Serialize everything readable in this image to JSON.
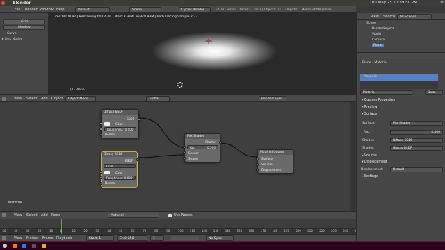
{
  "window": {
    "title": "Blender",
    "clock": "Thu May 25 10:39:50 PM",
    "user": "⚙"
  },
  "infobar": {
    "menus": [
      "File",
      "Render",
      "Window",
      "Help"
    ],
    "layout": "Default",
    "scene": "Scene",
    "engine": "Cycles Render",
    "stats": "v2.79 | Verts:4 | Faces:1 | Tris:2 | Objects:1/3 | Lamps:0/1 | Mem:83.60M | Plane"
  },
  "left_panel": {
    "buttons": [
      "Grid",
      "Monkey"
    ],
    "curve_label": "Curve:",
    "link_nodes": "▸ Link Nodes"
  },
  "viewport": {
    "hud": "Time:00:00.97 | Remaining:00:04.00 | Mem:8.93M, Peak:8.93M | Path Tracing Sample 7/32",
    "object": "(1) Plane"
  },
  "viewport_header": {
    "menus": [
      "View",
      "Select",
      "Add",
      "Object"
    ],
    "mode": "Object Mode",
    "orientation": "Global",
    "layer": "RenderLayer"
  },
  "nodes": {
    "diffuse": {
      "title": "Diffuse BSDF",
      "out": "BSDF",
      "color": "Color",
      "roughness": "Roughness: 0.000",
      "normal": "Normal"
    },
    "glossy": {
      "title": "Glossy BSDF",
      "out": "BSDF",
      "dist": "GGX",
      "color": "Color",
      "roughness": "Roughness: 0.000",
      "normal": "Normal"
    },
    "mix": {
      "title": "Mix Shader",
      "out": "Shader",
      "fac_label": "Fac",
      "fac": "0.500",
      "shader1": "Shader",
      "shader2": "Shader"
    },
    "output": {
      "title": "Material Output",
      "surface": "Surface",
      "volume": "Volume",
      "displacement": "Displacement"
    }
  },
  "node_editor": {
    "material_label": "Material"
  },
  "node_header": {
    "menus": [
      "View",
      "Select",
      "Add",
      "Node"
    ],
    "material": "Material",
    "use_nodes": "Use Nodes"
  },
  "timeline": {
    "ticks": [
      "-50",
      "-40",
      "-30",
      "-20",
      "-10",
      "0",
      "10",
      "20",
      "30",
      "40",
      "50",
      "60",
      "70",
      "80",
      "90",
      "100",
      "110",
      "120",
      "130",
      "140",
      "150",
      "160",
      "170",
      "180",
      "190",
      "200",
      "210",
      "220",
      "230",
      "240",
      "250"
    ],
    "menus": [
      "View",
      "Marker",
      "Frame",
      "Playback"
    ],
    "start": "Start:",
    "start_val": "1",
    "end": "End:",
    "end_val": "250",
    "current": "1",
    "sync": "No Sync"
  },
  "outliner": {
    "menus": [
      "View",
      "Search"
    ],
    "filter": "All Scenes",
    "items": [
      "Scene",
      "RenderLayers",
      "World",
      "Camera",
      "Plane"
    ]
  },
  "properties": {
    "breadcrumb": [
      "Plane",
      "Material"
    ],
    "slot": "Material",
    "mat_name": "Material",
    "data_btn": "Data",
    "sections": {
      "custom": "▸ Custom Properties",
      "preview": "▸ Preview",
      "surface": "▾ Surface",
      "volume": "▸ Volume",
      "displacement": "▾ Displacement",
      "settings": "▸ Settings"
    },
    "surface": {
      "surface_lbl": "Surface:",
      "surface_val": "Mix Shader",
      "fac_lbl": "Fac:",
      "fac_val": "0.500",
      "shader_lbl": "Shader:",
      "shader1": "Diffuse BSDF",
      "shader2": "Glossy BSDF"
    },
    "displacement": {
      "lbl": "Displacement:",
      "val": "Default"
    }
  },
  "colors": {
    "accent": "#5680c2",
    "glossy_border": "#d9a14a",
    "socket_shader": "#63c763",
    "socket_color": "#c7c729"
  }
}
